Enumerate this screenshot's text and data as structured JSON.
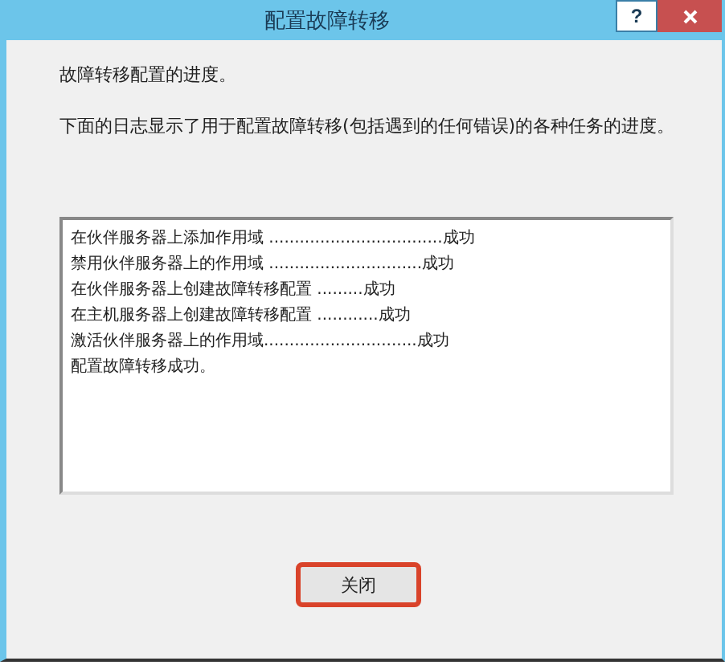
{
  "window": {
    "title": "配置故障转移",
    "help_button": "?"
  },
  "heading": "故障转移配置的进度。",
  "description": "下面的日志显示了用于配置故障转移(包括遇到的任何错误)的各种任务的进度。",
  "log": [
    "在伙伴服务器上添加作用域 ..................................成功",
    "禁用伙伴服务器上的作用域 ..............................成功",
    "在伙伴服务器上创建故障转移配置 .........成功",
    "在主机服务器上创建故障转移配置 ............成功",
    "激活伙伴服务器上的作用域..............................成功",
    "配置故障转移成功。"
  ],
  "close_button": {
    "label": "关闭",
    "highlighted": true
  }
}
